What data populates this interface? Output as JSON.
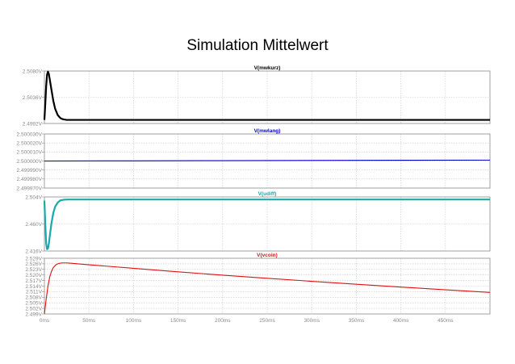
{
  "page_title": "Simulation Mittelwert",
  "chart_data": {
    "type": "line",
    "x_unit": "ms",
    "xlim": [
      0,
      500
    ],
    "x_ticks": [
      0,
      50,
      100,
      150,
      200,
      250,
      300,
      350,
      400,
      450
    ],
    "x_tick_labels": [
      "0ms",
      "50ms",
      "100ms",
      "150ms",
      "200ms",
      "250ms",
      "300ms",
      "350ms",
      "400ms",
      "450ms"
    ],
    "panels": [
      {
        "title": "V(mwkurz)",
        "color": "#000000",
        "ylim": [
          2.4992,
          2.508
        ],
        "y_ticks": [
          2.4992,
          2.5036,
          2.508
        ],
        "y_tick_labels": [
          "2.4992V",
          "2.5036V",
          "2.5080V"
        ],
        "series": [
          {
            "x": [
              0,
              1,
              2,
              3,
              4,
              5,
              6,
              8,
              10,
              12,
              15,
              18,
              21,
              25,
              30,
              40,
              60,
              100,
              200,
              300,
              400,
              500
            ],
            "y": [
              2.4998,
              2.5025,
              2.5055,
              2.5074,
              2.5079,
              2.5075,
              2.5066,
              2.5048,
              2.503,
              2.5017,
              2.5006,
              2.5001,
              2.4999,
              2.4998,
              2.4998,
              2.4998,
              2.4998,
              2.4998,
              2.4998,
              2.4998,
              2.4998,
              2.4998
            ]
          }
        ]
      },
      {
        "title": "V(mwlang)",
        "color": "#0000cc",
        "ylim": [
          2.49997,
          2.50003
        ],
        "y_ticks": [
          2.49997,
          2.49998,
          2.49999,
          2.5,
          2.50001,
          2.50002,
          2.50003
        ],
        "y_tick_labels": [
          "2.499970V",
          "2.499980V",
          "2.499990V",
          "2.500000V",
          "2.500010V",
          "2.500020V",
          "2.500030V"
        ],
        "series": [
          {
            "x": [
              0,
              100,
              200,
              300,
              400,
              500
            ],
            "y": [
              2.5,
              2.5000002,
              2.5000004,
              2.5000006,
              2.5000008,
              2.500001
            ]
          }
        ]
      },
      {
        "title": "V(udiff)",
        "color": "#1aa8a8",
        "ylim": [
          2.416,
          2.504
        ],
        "y_ticks": [
          2.416,
          2.46,
          2.504
        ],
        "y_tick_labels": [
          "2.416V",
          "2.460V",
          "2.504V"
        ],
        "series": [
          {
            "x": [
              0,
              1,
              2,
              3,
              4,
              5,
              6,
              8,
              10,
              12,
              15,
              18,
              22,
              26,
              30,
              40,
              60,
              100,
              200,
              300,
              400,
              500
            ],
            "y": [
              2.498,
              2.46,
              2.428,
              2.419,
              2.42,
              2.428,
              2.44,
              2.462,
              2.478,
              2.488,
              2.495,
              2.4985,
              2.4995,
              2.4998,
              2.4998,
              2.4998,
              2.4998,
              2.4998,
              2.4998,
              2.4998,
              2.4998,
              2.4998
            ]
          }
        ]
      },
      {
        "title": "V(vcoin)",
        "color": "#dd1111",
        "ylim": [
          2.499,
          2.529
        ],
        "y_ticks": [
          2.499,
          2.502,
          2.505,
          2.508,
          2.511,
          2.514,
          2.517,
          2.52,
          2.523,
          2.526,
          2.529
        ],
        "y_tick_labels": [
          "2.499V",
          "2.502V",
          "2.505V",
          "2.508V",
          "2.511V",
          "2.514V",
          "2.517V",
          "2.520V",
          "2.523V",
          "2.526V",
          "2.529V"
        ],
        "series": [
          {
            "x": [
              0,
              1,
              2,
              4,
              6,
              8,
              10,
              13,
              16,
              20,
              25,
              30,
              50,
              100,
              150,
              200,
              250,
              300,
              350,
              400,
              450,
              500
            ],
            "y": [
              2.499,
              2.503,
              2.507,
              2.514,
              2.519,
              2.522,
              2.524,
              2.5255,
              2.5262,
              2.5265,
              2.5265,
              2.5263,
              2.5255,
              2.5236,
              2.5217,
              2.5199,
              2.5182,
              2.5166,
              2.515,
              2.5135,
              2.512,
              2.5106
            ]
          }
        ]
      }
    ]
  }
}
